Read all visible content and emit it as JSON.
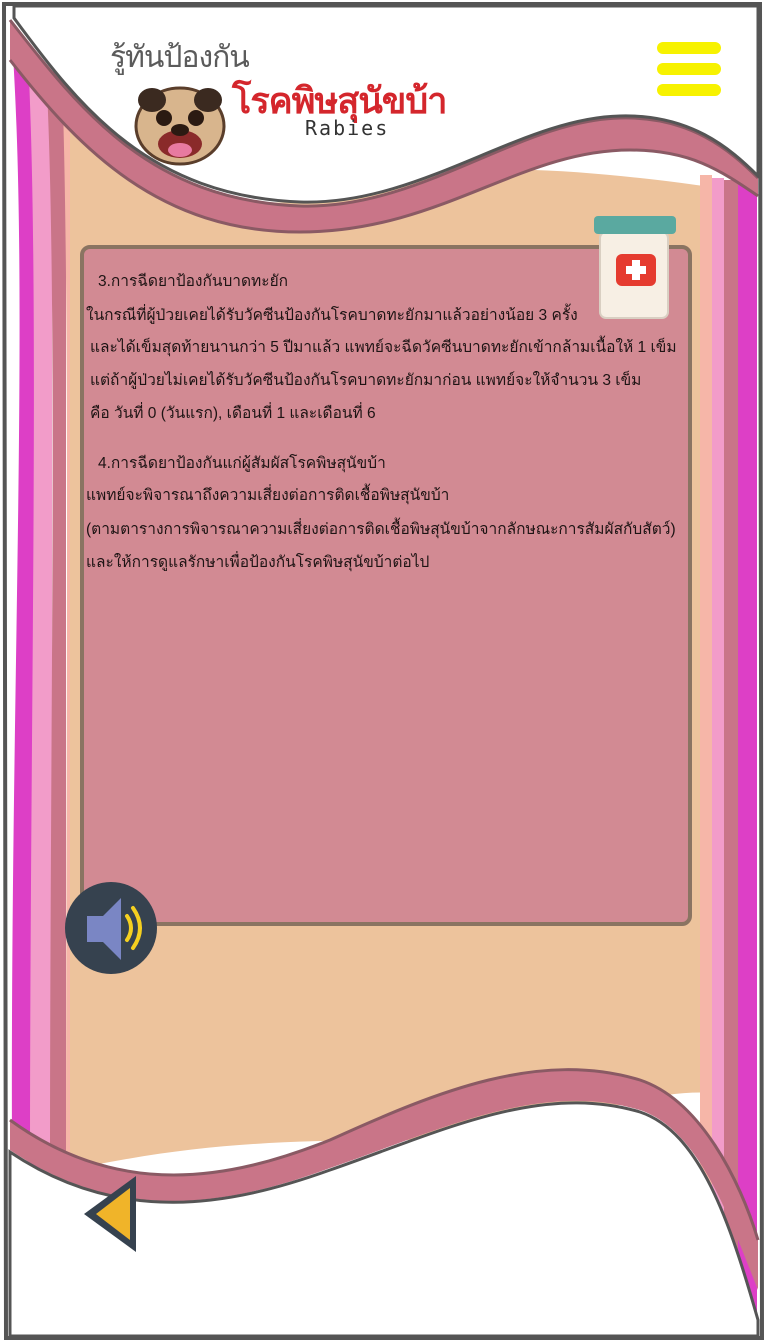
{
  "header": {
    "logo_line1": "รู้ทันป้องกัน",
    "logo_line2": "โรคพิษสุนัขบ้า",
    "logo_line3": "Rabies"
  },
  "icons": {
    "menu": "hamburger-menu-icon",
    "mascot": "pug-dog-logo",
    "medicine": "medicine-jar-icon",
    "audio": "speaker-icon",
    "back": "back-arrow-icon"
  },
  "content": {
    "section3": {
      "heading": "3.การฉีดยาป้องกันบาดทะยัก",
      "lines": [
        "ในกรณีที่ผู้ป่วยเคยได้รับวัคซีนป้องกันโรคบาดทะยักมาแล้วอย่างน้อย 3 ครั้ง",
        "และได้เข็มสุดท้ายนานกว่า 5 ปีมาแล้ว แพทย์จะฉีดวัคซีนบาดทะยักเข้ากล้ามเนื้อให้ 1 เข็ม",
        "แต่ถ้าผู้ป่วยไม่เคยได้รับวัคซีนป้องกันโรคบาดทะยักมาก่อน แพทย์จะให้จำนวน 3 เข็ม",
        "คือ วันที่ 0 (วันแรก), เดือนที่ 1 และเดือนที่ 6"
      ]
    },
    "section4": {
      "heading": "4.การฉีดยาป้องกันแก่ผู้สัมผัสโรคพิษสุนัขบ้า",
      "lines": [
        "แพทย์จะพิจารณาถึงความเสี่ยงต่อการติดเชื้อพิษสุนัขบ้า",
        "(ตามตารางการพิจารณาความเสี่ยงต่อการติดเชื้อพิษสุนัขบ้าจากลักษณะการสัมผัสกับสัตว์)",
        "และให้การดูแลรักษาเพื่อป้องกันโรคพิษสุนัขบ้าต่อไป"
      ]
    }
  },
  "colors": {
    "panel": "#d28a93",
    "panel_border": "#8a7462",
    "page_fill": "#edc39c",
    "wave_pink": "#c97588",
    "stripe_magenta": "#dd3fc6",
    "menu_yellow": "#f7f200",
    "logo_red": "#d4262c"
  }
}
